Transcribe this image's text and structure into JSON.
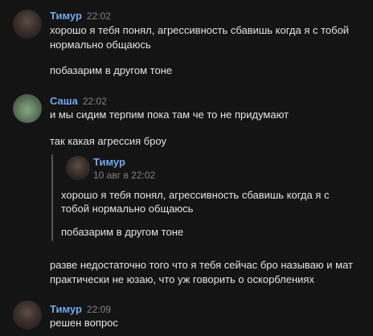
{
  "messages": [
    {
      "author": "Тимур",
      "time": "22:02",
      "avatar_icon": "user-avatar-icon",
      "lines": [
        "хорошо я тебя понял, агрессивность сбавишь когда я с тобой",
        "нормально общаюсь",
        "побазарим в другом тоне"
      ]
    },
    {
      "author": "Саша",
      "time": "22:02",
      "avatar_icon": "user-avatar-icon",
      "lines": [
        "и мы сидим терпим пока там че то не придумают",
        "так какая агрессия броу"
      ],
      "quote": {
        "author": "Тимур",
        "time": "10 авг в 22:02",
        "lines": [
          "хорошо я тебя понял, агрессивность сбавишь когда я с",
          "тобой нормально общаюсь",
          "побазарим в другом тоне"
        ]
      },
      "after_lines": [
        "разве недостаточно того что я тебя сейчас бро называю и мат",
        "практически не юзаю, что уж говорить о оскорблениях"
      ]
    },
    {
      "author": "Тимур",
      "time": "22:09",
      "avatar_icon": "user-avatar-icon",
      "lines": [
        "решен вопрос"
      ]
    }
  ]
}
